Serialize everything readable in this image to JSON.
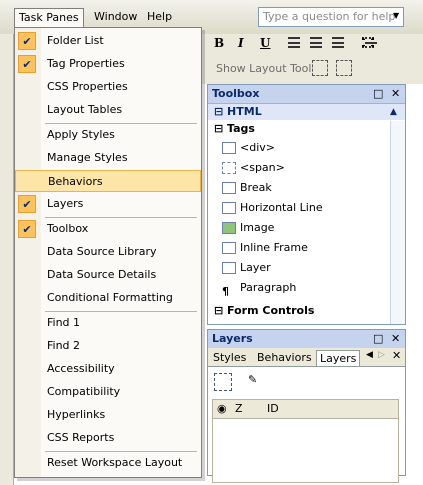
{
  "menubar": {
    "items": [
      "Task Panes",
      "Window",
      "Help"
    ],
    "question_placeholder": "Type a question for help"
  },
  "toolbar": {
    "bold": "B",
    "italic": "I",
    "underline": "U",
    "show_layout_tool": "Show Layout Tool"
  },
  "task_panes_menu": {
    "items": [
      {
        "label": "Folder List",
        "checked": true
      },
      {
        "label": "Tag Properties",
        "checked": true
      },
      {
        "label": "CSS Properties",
        "checked": false
      },
      {
        "label": "Layout Tables",
        "checked": false
      },
      {
        "label": "Apply Styles",
        "checked": false
      },
      {
        "label": "Manage Styles",
        "checked": false
      },
      {
        "label": "Behaviors",
        "checked": false,
        "highlighted": true
      },
      {
        "label": "Layers",
        "checked": true
      },
      {
        "label": "Toolbox",
        "checked": true
      },
      {
        "label": "Data Source Library",
        "checked": false
      },
      {
        "label": "Data Source Details",
        "checked": false
      },
      {
        "label": "Conditional Formatting",
        "checked": false
      },
      {
        "label": "Find 1",
        "checked": false
      },
      {
        "label": "Find 2",
        "checked": false
      },
      {
        "label": "Accessibility",
        "checked": false
      },
      {
        "label": "Compatibility",
        "checked": false
      },
      {
        "label": "Hyperlinks",
        "checked": false
      },
      {
        "label": "CSS Reports",
        "checked": false
      },
      {
        "label": "Reset Workspace Layout",
        "checked": false
      }
    ]
  },
  "toolbox": {
    "title": "Toolbox",
    "group": "HTML",
    "section": "Tags",
    "items": [
      "<div>",
      "<span>",
      "Break",
      "Horizontal Line",
      "Image",
      "Inline Frame",
      "Layer",
      "Paragraph"
    ],
    "next_section": "Form Controls"
  },
  "layers": {
    "title": "Layers",
    "tabs": [
      "Styles",
      "Behaviors",
      "Layers"
    ],
    "columns": [
      "Z",
      "ID"
    ]
  },
  "colors": {
    "menu_highlight": "#fde5a7",
    "check_bg": "#fcc25d",
    "panel_header": "#c6d3ef"
  }
}
